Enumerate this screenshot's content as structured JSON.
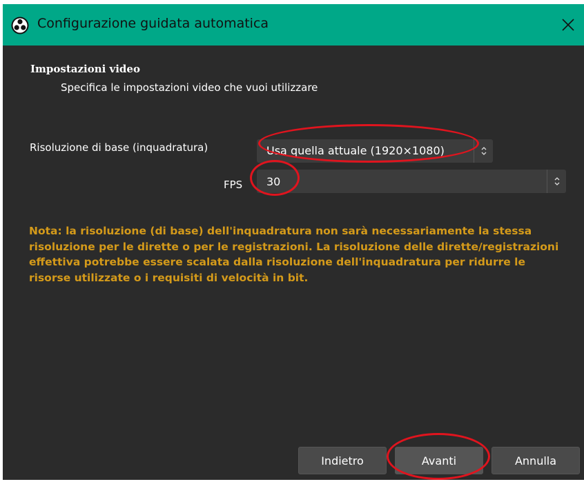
{
  "window": {
    "title": "Configurazione guidata automatica",
    "app_icon": "obs-logo-icon",
    "close_icon": "close-icon",
    "titlebar_color": "#00a888",
    "background_color": "#2b2b2b"
  },
  "section": {
    "title": "Impostazioni video",
    "subtitle": "Specifica le impostazioni video che vuoi utilizzare"
  },
  "resolution": {
    "label": "Risoluzione di base (inquadratura)",
    "value": "Usa quella attuale (1920×1080)"
  },
  "fps": {
    "label": "FPS",
    "value": "30"
  },
  "note": {
    "text": "Nota: la risoluzione (di base) dell'inquadratura non sarà necessariamente la stessa risoluzione per le dirette o per le registrazioni. La risoluzione delle dirette/registrazioni effettiva potrebbe essere scalata dalla risoluzione dell'inquadratura per ridurre le risorse utilizzate o i requisiti di velocità in bit.",
    "color": "#d49a1a"
  },
  "buttons": {
    "back": "Indietro",
    "next": "Avanti",
    "cancel": "Annulla"
  },
  "annotations": {
    "color": "#e0141e"
  }
}
